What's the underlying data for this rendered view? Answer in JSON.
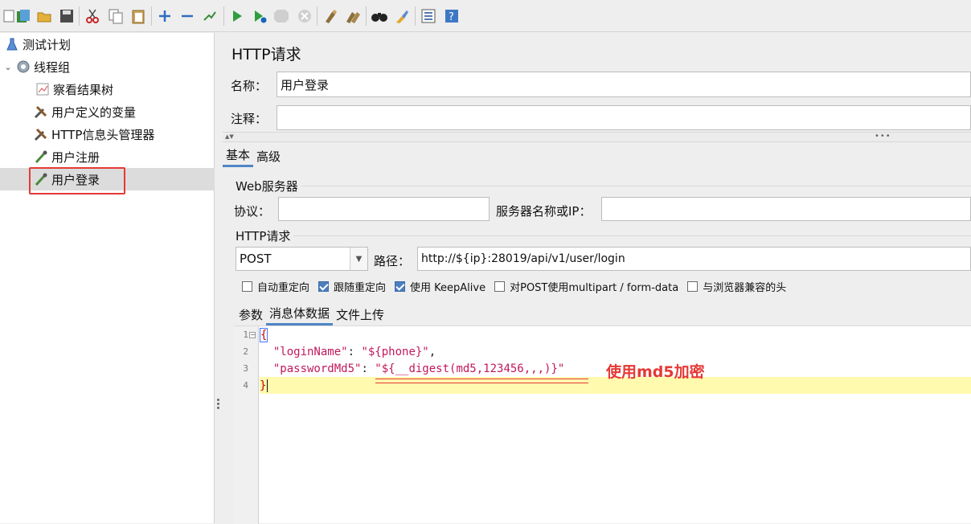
{
  "toolbar": {
    "icons": [
      "new-icon",
      "templates-icon",
      "open-icon",
      "save-icon",
      "cut-icon",
      "copy-icon",
      "paste-icon",
      "expand-icon",
      "collapse-icon",
      "toggle-icon",
      "start-icon",
      "start-no-pause-icon",
      "stop-icon",
      "shutdown-icon",
      "clear-icon",
      "clear-all-icon",
      "search-icon",
      "reset-search-icon",
      "function-helper-icon",
      "help-icon"
    ]
  },
  "tree": {
    "items": [
      {
        "label": "测试计划",
        "icon": "flask-icon"
      },
      {
        "label": "线程组",
        "icon": "gear-icon"
      },
      {
        "label": "察看结果树",
        "icon": "chart-icon"
      },
      {
        "label": "用户定义的变量",
        "icon": "wrench-icon"
      },
      {
        "label": "HTTP信息头管理器",
        "icon": "wrench-icon"
      },
      {
        "label": "用户注册",
        "icon": "pipette-icon"
      },
      {
        "label": "用户登录",
        "icon": "pipette-icon"
      }
    ]
  },
  "panel": {
    "title": "HTTP请求",
    "name_label": "名称：",
    "name_value": "用户登录",
    "comment_label": "注释：",
    "comment_value": "",
    "tabs": [
      "基本",
      "高级"
    ],
    "web_server": {
      "group_title": "Web服务器",
      "protocol_label": "协议：",
      "protocol_value": "",
      "server_label": "服务器名称或IP：",
      "server_value": ""
    },
    "http": {
      "group_title": "HTTP请求",
      "method": "POST",
      "path_label": "路径：",
      "path_value": "http://${ip}:28019/api/v1/user/login"
    },
    "checkboxes": [
      {
        "label": "自动重定向",
        "checked": false
      },
      {
        "label": "跟随重定向",
        "checked": true
      },
      {
        "label": "使用 KeepAlive",
        "checked": true
      },
      {
        "label": "对POST使用multipart / form-data",
        "checked": false
      },
      {
        "label": "与浏览器兼容的头",
        "checked": false
      }
    ],
    "body_tabs": [
      "参数",
      "消息体数据",
      "文件上传"
    ],
    "editor": {
      "line_numbers": [
        "1",
        "2",
        "3",
        "4"
      ],
      "open_brace": "{",
      "key1": "\"loginName\"",
      "val1": "\"${phone}\"",
      "key2": "\"passwordMd5\"",
      "val2": "\"${__digest(md5,123456,,,)}\"",
      "close_brace": "}"
    },
    "annotation": "使用md5加密"
  }
}
